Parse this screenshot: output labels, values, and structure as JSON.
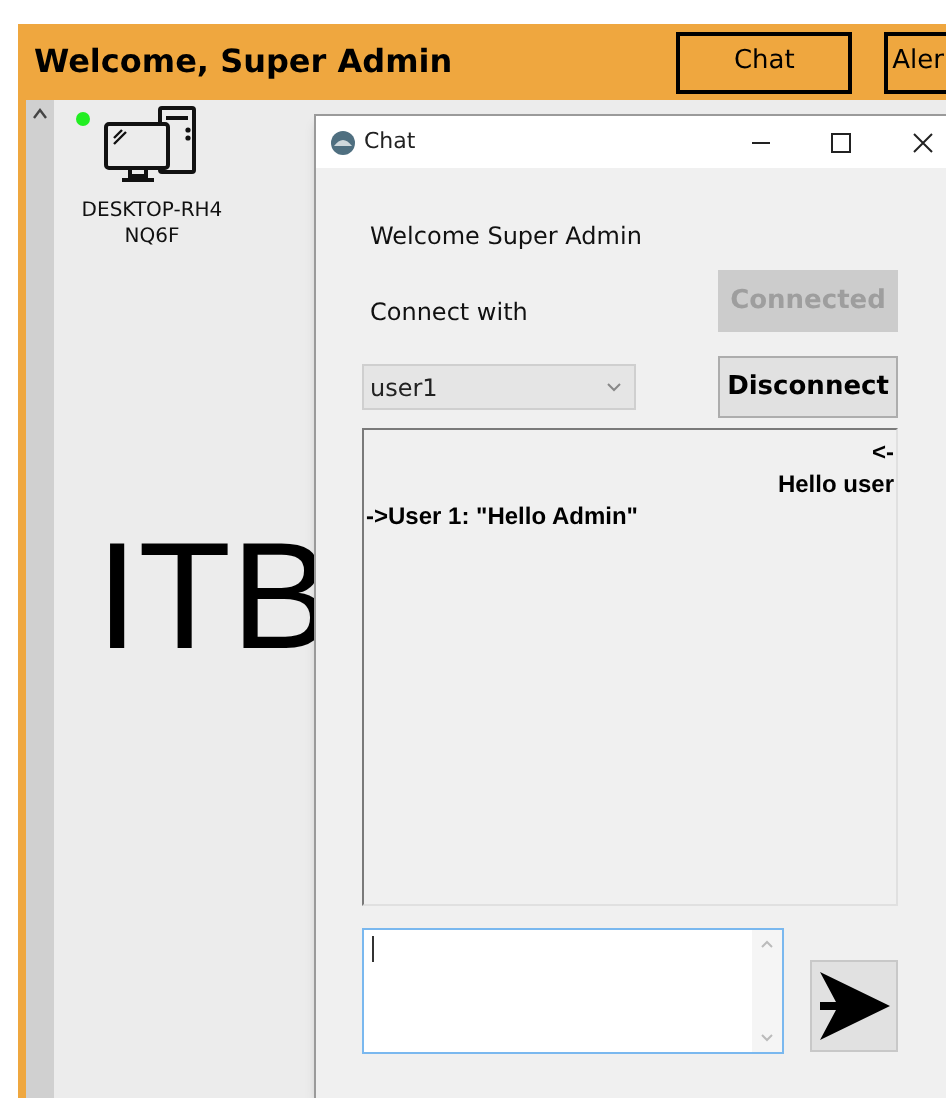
{
  "header": {
    "title": "Welcome, Super Admin",
    "buttons": [
      {
        "label": "Chat"
      },
      {
        "label": "Aler"
      }
    ]
  },
  "devices": [
    {
      "name": "DESKTOP-RH4NQ6F",
      "online": true
    }
  ],
  "background_text": "ITB",
  "chat_window": {
    "title": "Chat",
    "welcome": "Welcome Super Admin",
    "connect_label": "Connect with",
    "connect_button": {
      "label": "Connected",
      "disabled": true
    },
    "user_select": {
      "value": "user1"
    },
    "disconnect_button": {
      "label": "Disconnect",
      "disabled": false
    },
    "messages": [
      {
        "text": "<-",
        "kind": "outgoing"
      },
      {
        "text": "Hello user",
        "kind": "outgoing"
      },
      {
        "text": "->User 1: \"Hello Admin\"",
        "kind": "incoming"
      }
    ],
    "message_input": {
      "focused": true
    }
  }
}
